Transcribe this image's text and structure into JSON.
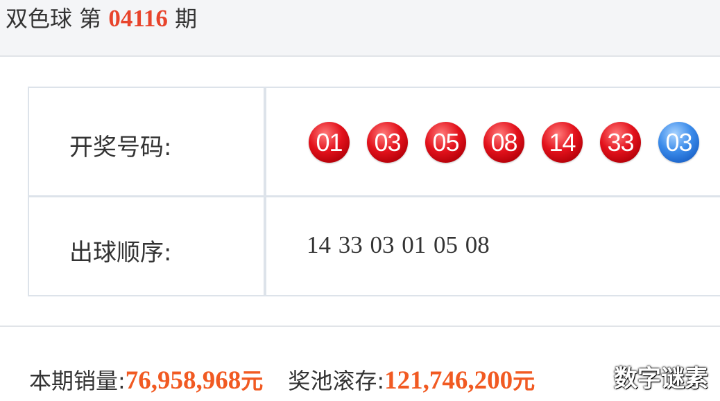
{
  "header": {
    "title_prefix": "双色球 第",
    "issue_number": "04116",
    "title_suffix": "期"
  },
  "results": {
    "winning_label": "开奖号码:",
    "red_balls": [
      "01",
      "03",
      "05",
      "08",
      "14",
      "33"
    ],
    "blue_ball": "03",
    "order_label": "出球顺序:",
    "draw_order": "14 33 03 01 05 08"
  },
  "footer": {
    "sales_label": "本期销量:",
    "sales_amount": "76,958,968",
    "sales_unit": "元",
    "pool_label": "奖池滚存:",
    "pool_amount": "121,746,200",
    "pool_unit": "元"
  },
  "watermark": "数字谜素",
  "colors": {
    "issue_red": "#e8442c",
    "amount_orange": "#f15a22",
    "red_ball": "#e3121c",
    "blue_ball": "#1b63c9",
    "border": "#dde3ea",
    "header_bg": "#f4f5f7"
  }
}
